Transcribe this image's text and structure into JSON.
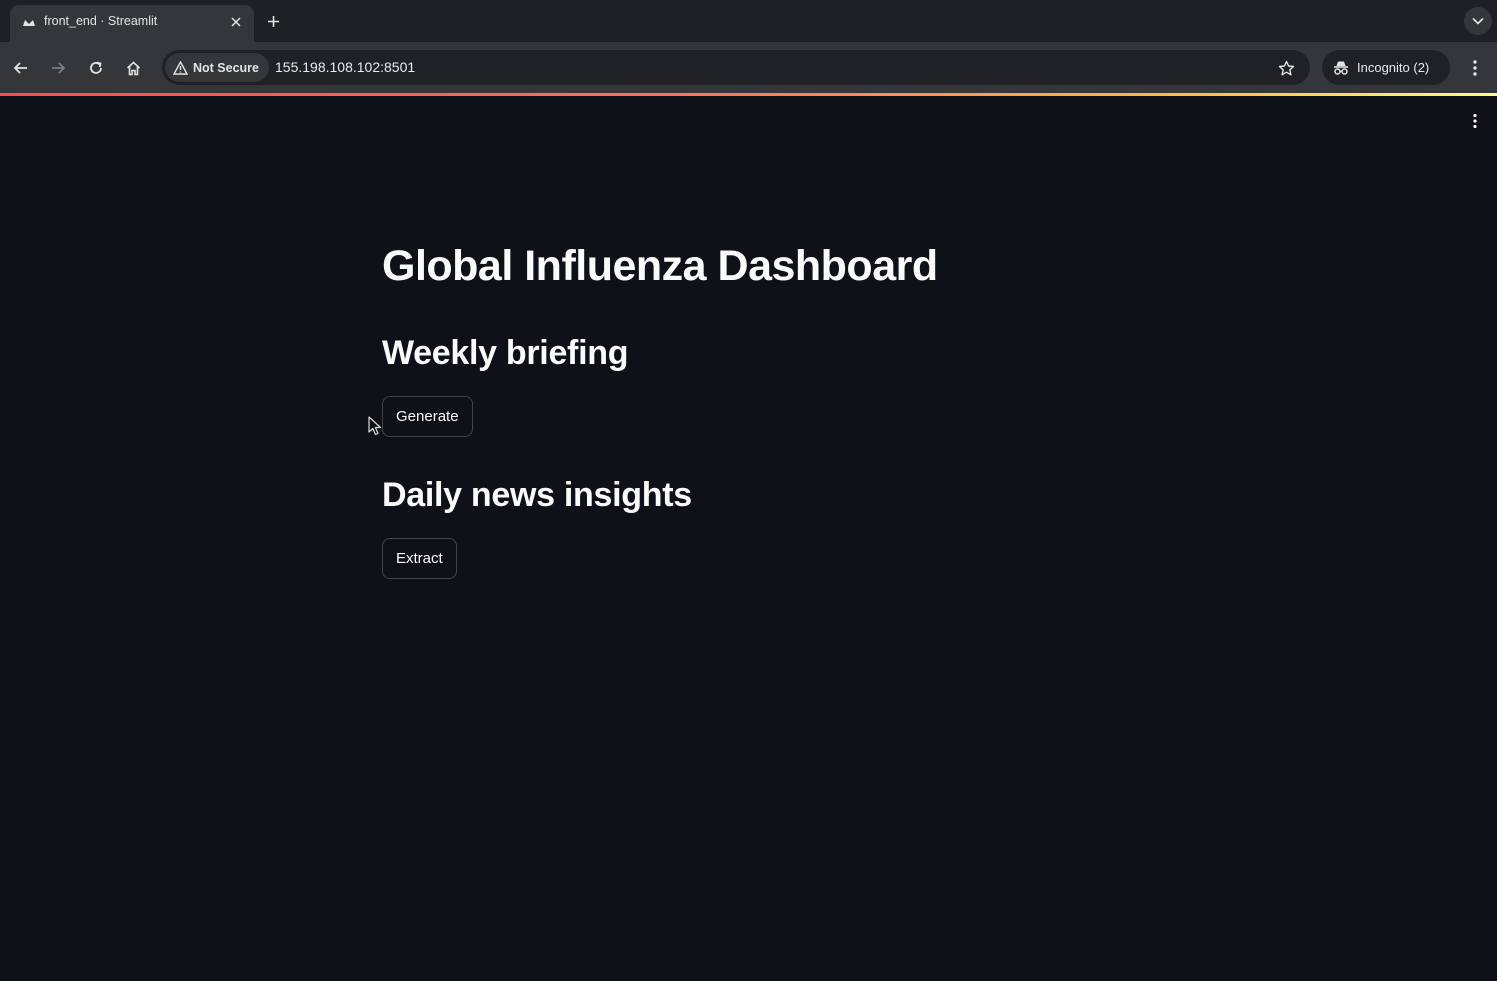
{
  "browser": {
    "tab": {
      "title": "front_end · Streamlit",
      "favicon": "streamlit-crown-icon"
    },
    "toolbar": {
      "security_label": "Not Secure",
      "url": "155.198.108.102:8501",
      "incognito_label": "Incognito (2)"
    },
    "progress_gradient": [
      "#ff4b4b",
      "#ffbd45",
      "#fffd80"
    ]
  },
  "app": {
    "title": "Global Influenza Dashboard",
    "sections": [
      {
        "heading": "Weekly briefing",
        "button_label": "Generate"
      },
      {
        "heading": "Daily news insights",
        "button_label": "Extract"
      }
    ]
  },
  "colors": {
    "background": "#0e1117",
    "text": "#fafafa",
    "chrome_tabstrip": "#1f2023",
    "chrome_toolbar": "#35363a"
  }
}
